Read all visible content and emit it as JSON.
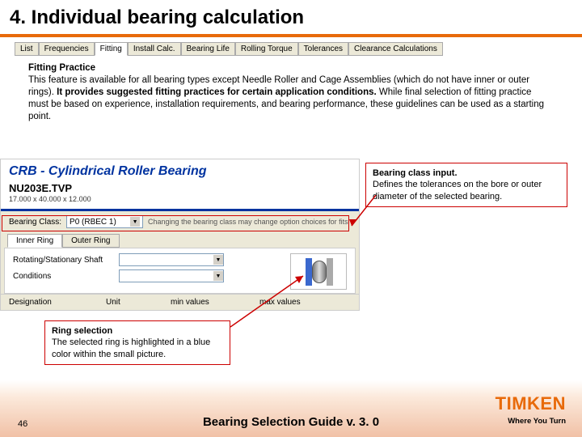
{
  "title": "4. Individual bearing calculation",
  "tabs": [
    "List",
    "Frequencies",
    "Fitting",
    "Install Calc.",
    "Bearing Life",
    "Rolling Torque",
    "Tolerances",
    "Clearance Calculations"
  ],
  "active_tab_index": 2,
  "paragraph": {
    "heading": "Fitting Practice",
    "line1": "This feature is available for all bearing types except Needle Roller and Cage Assemblies (which do not have inner or outer rings). ",
    "bold_mid": "It provides suggested fitting practices for certain application conditions.",
    "line2": " While final selection of fitting practice must be based on experience, installation requirements, and bearing performance, these guidelines can be used as a starting point."
  },
  "app": {
    "title": "CRB - Cylindrical Roller Bearing",
    "bearing_number": "NU203E.TVP",
    "bearing_dims": "17.000 x 40.000 x 12.000",
    "bearing_class_label": "Bearing Class:",
    "bearing_class_value": "P0 (RBEC 1)",
    "bearing_class_hint": "Changing the bearing class may change option choices for fits",
    "subtabs": [
      "Inner Ring",
      "Outer Ring"
    ],
    "active_subtab_index": 0,
    "field1": "Rotating/Stationary Shaft",
    "field2": "Conditions",
    "col1": "Designation",
    "col2": "Unit",
    "col3": "min values",
    "col4": "max values"
  },
  "callouts": {
    "bci_heading": "Bearing class input.",
    "bci_body": "Defines the tolerances on the bore or outer diameter of the selected bearing.",
    "ring_heading": "Ring selection",
    "ring_body": "The selected ring is highlighted in a blue color within the small picture."
  },
  "footer": {
    "page": "46",
    "title": "Bearing Selection Guide v. 3. 0",
    "logo": "TIMKEN",
    "tagline": "Where You Turn"
  }
}
